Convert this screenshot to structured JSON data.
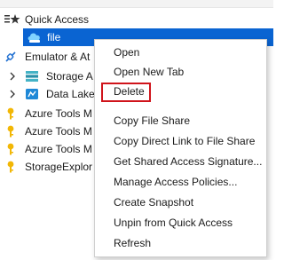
{
  "tree": {
    "items": [
      {
        "label": "Quick Access",
        "icon": "quick-access-icon"
      },
      {
        "label": "file",
        "icon": "file-share-icon",
        "selected": true
      },
      {
        "label": "Emulator & At",
        "icon": "plug-icon"
      },
      {
        "label": "Storage A",
        "icon": "storage-account-icon"
      },
      {
        "label": "Data Lake",
        "icon": "data-lake-icon"
      },
      {
        "label": "Azure Tools M",
        "icon": "key-icon"
      },
      {
        "label": "Azure Tools M",
        "icon": "key-icon"
      },
      {
        "label": "Azure Tools M",
        "icon": "key-icon"
      },
      {
        "label": "StorageExplor",
        "icon": "key-icon"
      }
    ]
  },
  "context_menu": {
    "items": [
      "Open",
      "Open New Tab",
      "Delete",
      "Copy File Share",
      "Copy Direct Link to File Share",
      "Get Shared Access Signature...",
      "Manage Access Policies...",
      "Create Snapshot",
      "Unpin from Quick Access",
      "Refresh"
    ],
    "highlighted": "Delete",
    "highlight_color": "#d0141b"
  },
  "colors": {
    "selection": "#0a64d2",
    "key": "#f2b705"
  }
}
